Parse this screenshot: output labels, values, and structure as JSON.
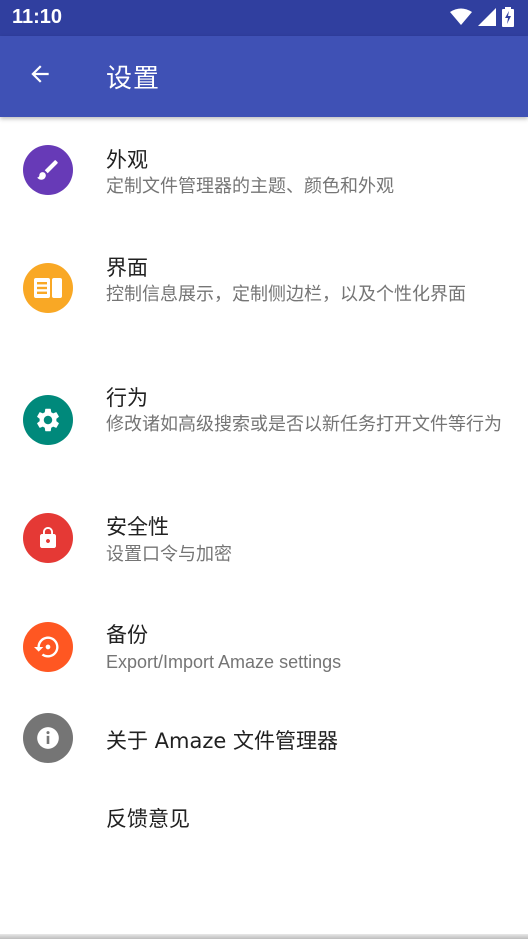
{
  "status_bar": {
    "time": "11:10"
  },
  "app_bar": {
    "title": "设置"
  },
  "items": [
    {
      "title": "外观",
      "summary": "定制文件管理器的主题、颜色和外观",
      "icon": "paint-brush-icon",
      "color": "#673ab7"
    },
    {
      "title": "界面",
      "summary": "控制信息展示，定制侧边栏，以及个性化界面",
      "icon": "view-list-icon",
      "color": "#f9a825"
    },
    {
      "title": "行为",
      "summary": "修改诸如高级搜索或是否以新任务打开文件等行为",
      "icon": "gear-icon",
      "color": "#00897b"
    },
    {
      "title": "安全性",
      "summary": "设置口令与加密",
      "icon": "lock-icon",
      "color": "#e53935"
    },
    {
      "title": "备份",
      "summary": "Export/Import Amaze settings",
      "icon": "backup-restore-icon",
      "color": "#ff5722"
    },
    {
      "title": "关于 Amaze 文件管理器",
      "summary": "",
      "icon": "info-icon",
      "color": "#757575"
    },
    {
      "title": "反馈意见",
      "summary": "",
      "icon": "",
      "color": ""
    }
  ]
}
